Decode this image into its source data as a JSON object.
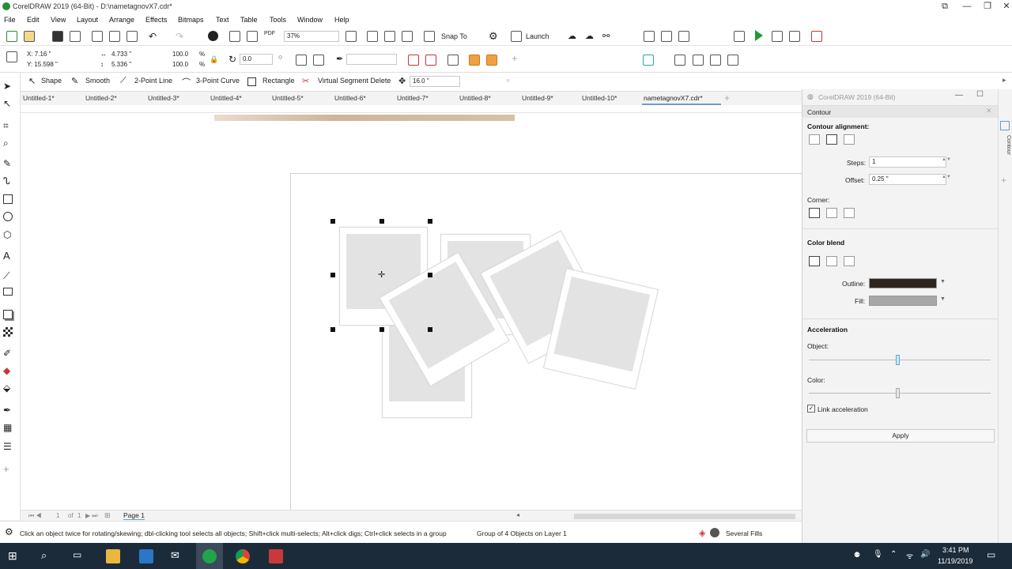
{
  "title_bar": {
    "title": "CorelDRAW 2019 (64-Bit) - D:\\nametagnovX7.cdr*"
  },
  "menu": [
    "File",
    "Edit",
    "View",
    "Layout",
    "Arrange",
    "Effects",
    "Bitmaps",
    "Text",
    "Table",
    "Tools",
    "Window",
    "Help"
  ],
  "toolbar1": {
    "zoom": "37%",
    "snap": "Snap To",
    "launch": "Launch",
    "pdf": "PDF"
  },
  "toolbar2": {
    "x": "X: 7.16 \"",
    "y": "Y: 15.598 \"",
    "w": "4.733 \"",
    "h": "5.336 \"",
    "sx": "100.0",
    "sy": "100.0",
    "pct": "%",
    "angle": "0.0"
  },
  "toolbar3": {
    "shape": "Shape",
    "smooth": "Smooth",
    "two_point": "2-Point Line",
    "three_point": "3-Point Curve",
    "rectangle": "Rectangle",
    "virtual": "Virtual Segment Delete",
    "size": "16.0 \""
  },
  "tabs": [
    "Untitled-1*",
    "Untitled-2*",
    "Untitled-3*",
    "Untitled-4*",
    "Untitled-5*",
    "Untitled-6*",
    "Untitled-7*",
    "Untitled-8*",
    "Untitled-9*",
    "Untitled-10*",
    "nametagnovX7.cdr*"
  ],
  "page_nav": {
    "of": "1",
    "of_label": "of",
    "page_label": "Page 1"
  },
  "status": {
    "hint": "Click an object twice for rotating/skewing; dbl-clicking tool selects all objects; Shift+click multi-selects; Alt+click digs; Ctrl+click selects in a group",
    "selection": "Group of 4 Objects on Layer 1",
    "fills": "Several Fills"
  },
  "docker": {
    "window_title": "CorelDRAW 2019 (64-Bit)",
    "panel_title": "Contour",
    "alignment_label": "Contour alignment:",
    "steps_label": "Steps:",
    "steps_value": "1",
    "offset_label": "Offset:",
    "offset_value": "0.25 \"",
    "corner_label": "Corner:",
    "color_blend_label": "Color blend",
    "outline_label": "Outline:",
    "fill_label": "Fill:",
    "outline_color": "#2e2521",
    "fill_color": "#a7a7a7",
    "acceleration_label": "Acceleration",
    "object_label": "Object:",
    "color_label": "Color:",
    "link_label": "Link acceleration",
    "apply_label": "Apply",
    "side_tab": "Contour",
    "object_accel": 0.48,
    "color_accel": 0.48
  },
  "taskbar": {
    "time": "3:41 PM",
    "date": "11/19/2019"
  }
}
